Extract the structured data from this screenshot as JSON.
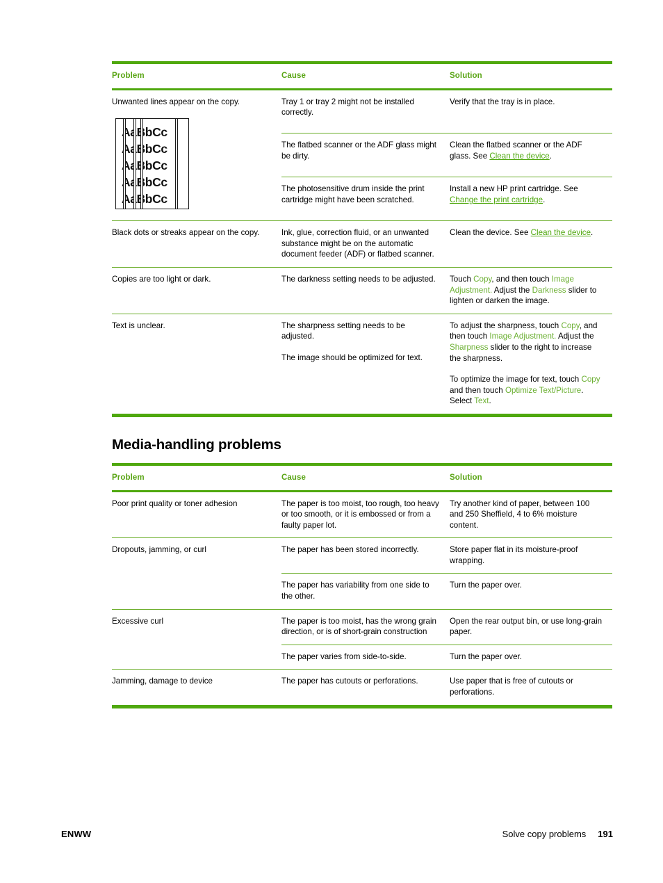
{
  "colors": {
    "accent_green": "#4fa80e",
    "header_text_green": "#5aa515",
    "ui_term_green": "#6cb033",
    "link_green": "#4fa80e",
    "rule_green": "#6aad28",
    "body_text": "#000000"
  },
  "table_headers": {
    "problem": "Problem",
    "cause": "Cause",
    "solution": "Solution"
  },
  "copy_table": {
    "rows": [
      {
        "problem": "Unwanted lines appear on the copy.",
        "has_figure": true,
        "figure": {
          "sample_text": "AaBbCc",
          "line_count": 5,
          "streak_count": 4
        },
        "subrows": [
          {
            "cause": "Tray 1 or tray 2 might not be installed correctly.",
            "solution_plain": "Verify that the tray is in place.",
            "solution_parts": [
              {
                "type": "text",
                "value": "Verify that the tray is in place."
              }
            ]
          },
          {
            "cause": "The flatbed scanner or the ADF glass might be dirty.",
            "solution_plain": "Clean the flatbed scanner or the ADF glass. See Clean the device.",
            "solution_parts": [
              {
                "type": "text",
                "value": "Clean the flatbed scanner or the ADF glass. See "
              },
              {
                "type": "link",
                "value": "Clean the device"
              },
              {
                "type": "text",
                "value": "."
              }
            ]
          },
          {
            "cause": "The photosensitive drum inside the print cartridge might have been scratched.",
            "solution_plain": "Install a new HP print cartridge. See Change the print cartridge.",
            "solution_parts": [
              {
                "type": "text",
                "value": "Install a new HP print cartridge. See "
              },
              {
                "type": "link",
                "value": "Change the print cartridge"
              },
              {
                "type": "text",
                "value": "."
              }
            ]
          }
        ]
      },
      {
        "problem": "Black dots or streaks appear on the copy.",
        "has_figure": false,
        "subrows": [
          {
            "cause": "Ink, glue, correction fluid, or an unwanted substance might be on the automatic document feeder (ADF) or flatbed scanner.",
            "solution_plain": "Clean the device. See Clean the device.",
            "solution_parts": [
              {
                "type": "text",
                "value": "Clean the device. See "
              },
              {
                "type": "link",
                "value": "Clean the device"
              },
              {
                "type": "text",
                "value": "."
              }
            ]
          }
        ]
      },
      {
        "problem": "Copies are too light or dark.",
        "has_figure": false,
        "subrows": [
          {
            "cause": "The darkness setting needs to be adjusted.",
            "solution_plain": "Touch Copy, and then touch Image Adjustment. Adjust the Darkness slider to lighten or darken the image.",
            "solution_parts": [
              {
                "type": "text",
                "value": "Touch "
              },
              {
                "type": "term",
                "value": "Copy"
              },
              {
                "type": "text",
                "value": ", and then touch "
              },
              {
                "type": "term",
                "value": "Image Adjustment."
              },
              {
                "type": "text",
                "value": " Adjust the "
              },
              {
                "type": "term",
                "value": "Darkness"
              },
              {
                "type": "text",
                "value": " slider to lighten or darken the image."
              }
            ]
          }
        ]
      },
      {
        "problem": "Text is unclear.",
        "has_figure": false,
        "subrows": [
          {
            "cause_paragraphs": [
              "The sharpness setting needs to be adjusted.",
              "The image should be optimized for text."
            ],
            "solution_paragraphs": [
              {
                "plain": "To adjust the sharpness, touch Copy, and then touch Image Adjustment. Adjust the Sharpness slider to the right to increase the sharpness.",
                "parts": [
                  {
                    "type": "text",
                    "value": "To adjust the sharpness, touch "
                  },
                  {
                    "type": "term",
                    "value": "Copy"
                  },
                  {
                    "type": "text",
                    "value": ", and then touch "
                  },
                  {
                    "type": "term",
                    "value": "Image Adjustment."
                  },
                  {
                    "type": "text",
                    "value": " Adjust the "
                  },
                  {
                    "type": "term",
                    "value": "Sharpness"
                  },
                  {
                    "type": "text",
                    "value": " slider to the right to increase the sharpness."
                  }
                ]
              },
              {
                "plain": "To optimize the image for text, touch Copy and then touch Optimize Text/Picture. Select Text.",
                "parts": [
                  {
                    "type": "text",
                    "value": "To optimize the image for text, touch "
                  },
                  {
                    "type": "term",
                    "value": "Copy"
                  },
                  {
                    "type": "text",
                    "value": " and then touch "
                  },
                  {
                    "type": "term",
                    "value": "Optimize Text/Picture"
                  },
                  {
                    "type": "text",
                    "value": ". Select "
                  },
                  {
                    "type": "term",
                    "value": "Text"
                  },
                  {
                    "type": "text",
                    "value": "."
                  }
                ]
              }
            ]
          }
        ]
      }
    ]
  },
  "media_section": {
    "heading": "Media-handling problems",
    "rows": [
      {
        "problem": "Poor print quality or toner adhesion",
        "subrows": [
          {
            "cause": "The paper is too moist, too rough, too heavy or too smooth, or it is embossed or from a faulty paper lot.",
            "solution": "Try another kind of paper, between 100 and 250 Sheffield, 4 to 6% moisture content."
          }
        ]
      },
      {
        "problem": "Dropouts, jamming, or curl",
        "subrows": [
          {
            "cause": "The paper has been stored incorrectly.",
            "solution": "Store paper flat in its moisture-proof wrapping."
          },
          {
            "cause": "The paper has variability from one side to the other.",
            "solution": "Turn the paper over."
          }
        ]
      },
      {
        "problem": "Excessive curl",
        "subrows": [
          {
            "cause": "The paper is too moist, has the wrong grain direction, or is of short-grain construction",
            "solution": "Open the rear output bin, or use long-grain paper."
          },
          {
            "cause": "The paper varies from side-to-side.",
            "solution": "Turn the paper over."
          }
        ]
      },
      {
        "problem": "Jamming, damage to device",
        "subrows": [
          {
            "cause": "The paper has cutouts or perforations.",
            "solution": "Use paper that is free of cutouts or perforations."
          }
        ]
      }
    ]
  },
  "footer": {
    "left": "ENWW",
    "section_title": "Solve copy problems",
    "page_number": "191"
  }
}
